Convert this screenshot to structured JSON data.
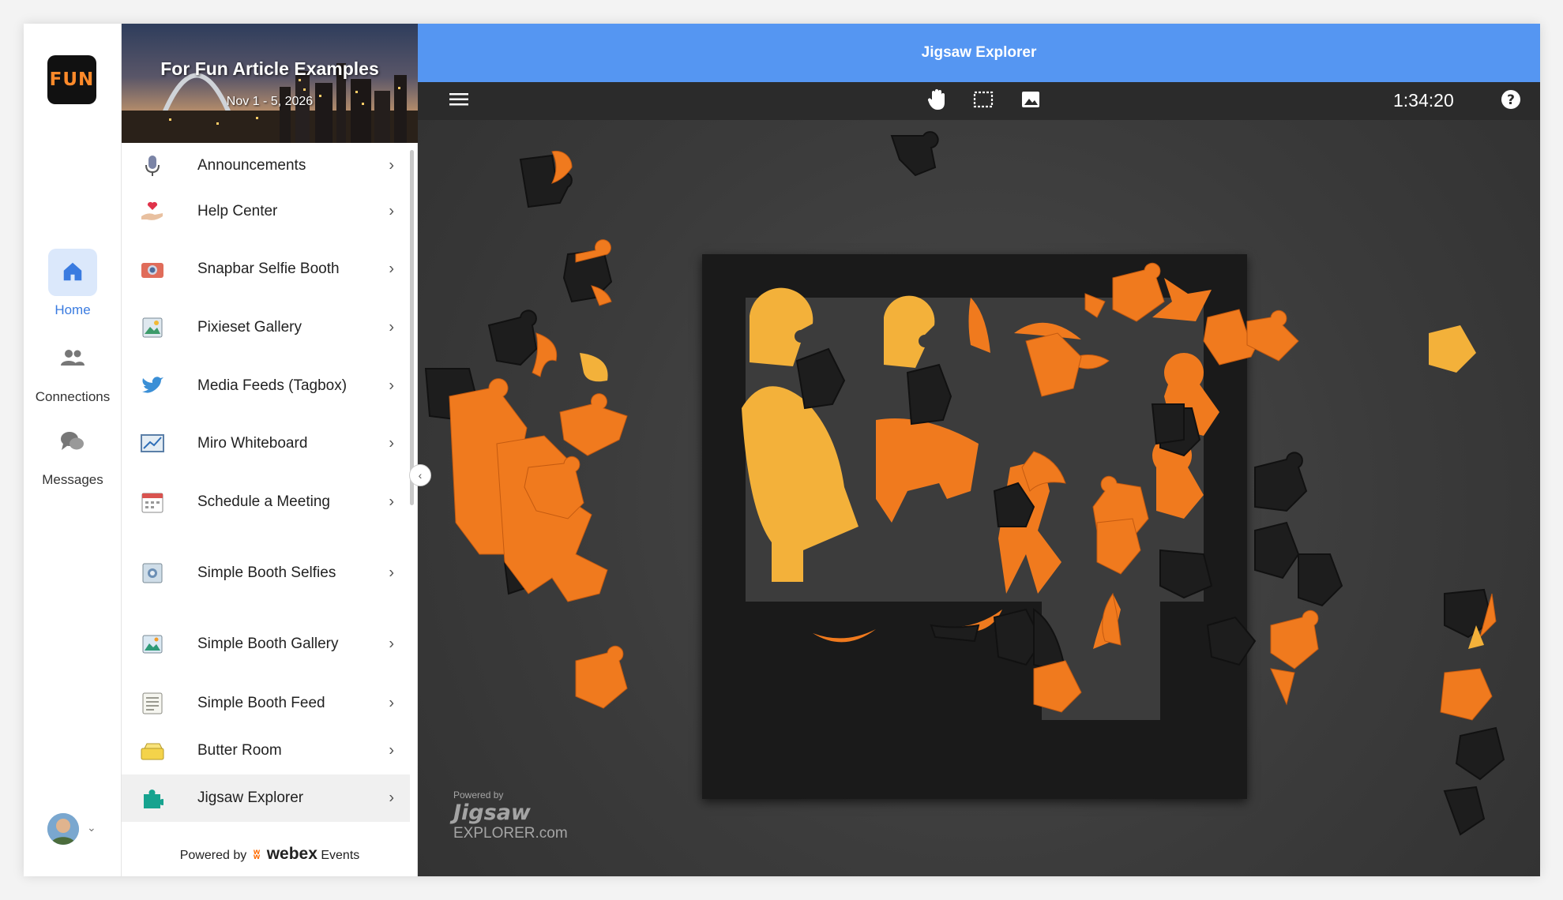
{
  "rail": {
    "logo_text": "FUN",
    "items": [
      {
        "label": "Home"
      },
      {
        "label": "Connections"
      },
      {
        "label": "Messages"
      }
    ]
  },
  "sidebar": {
    "banner_title": "For Fun Article Examples",
    "banner_date": "Nov 1 - 5, 2026",
    "items": [
      {
        "label": "Announcements",
        "icon": "microphone-icon"
      },
      {
        "label": "Help Center",
        "icon": "heart-hand-icon"
      },
      {
        "label": "Snapbar Selfie Booth",
        "icon": "camera-icon"
      },
      {
        "label": "Pixieset Gallery",
        "icon": "gallery-icon"
      },
      {
        "label": "Media Feeds (Tagbox)",
        "icon": "twitter-bird-icon"
      },
      {
        "label": "Miro Whiteboard",
        "icon": "whiteboard-icon"
      },
      {
        "label": "Schedule a Meeting",
        "icon": "calendar-icon"
      },
      {
        "label": "Simple Booth Selfies",
        "icon": "photo-icon"
      },
      {
        "label": "Simple Booth Gallery",
        "icon": "landscape-icon"
      },
      {
        "label": "Simple Booth Feed",
        "icon": "feed-icon"
      },
      {
        "label": "Butter Room",
        "icon": "butter-icon"
      },
      {
        "label": "Jigsaw Explorer",
        "icon": "puzzle-icon"
      }
    ],
    "powered_prefix": "Powered by",
    "powered_brand": "webex",
    "powered_suffix": "Events"
  },
  "main": {
    "title": "Jigsaw Explorer",
    "timer": "1:34:20",
    "watermark_small": "Powered by",
    "watermark_big": "Jigsaw",
    "watermark_sub": "EXPLORER.com"
  },
  "colors": {
    "accent": "#5596f2",
    "puzzle_orange": "#f07a1e",
    "puzzle_yellow": "#f3b13a"
  }
}
